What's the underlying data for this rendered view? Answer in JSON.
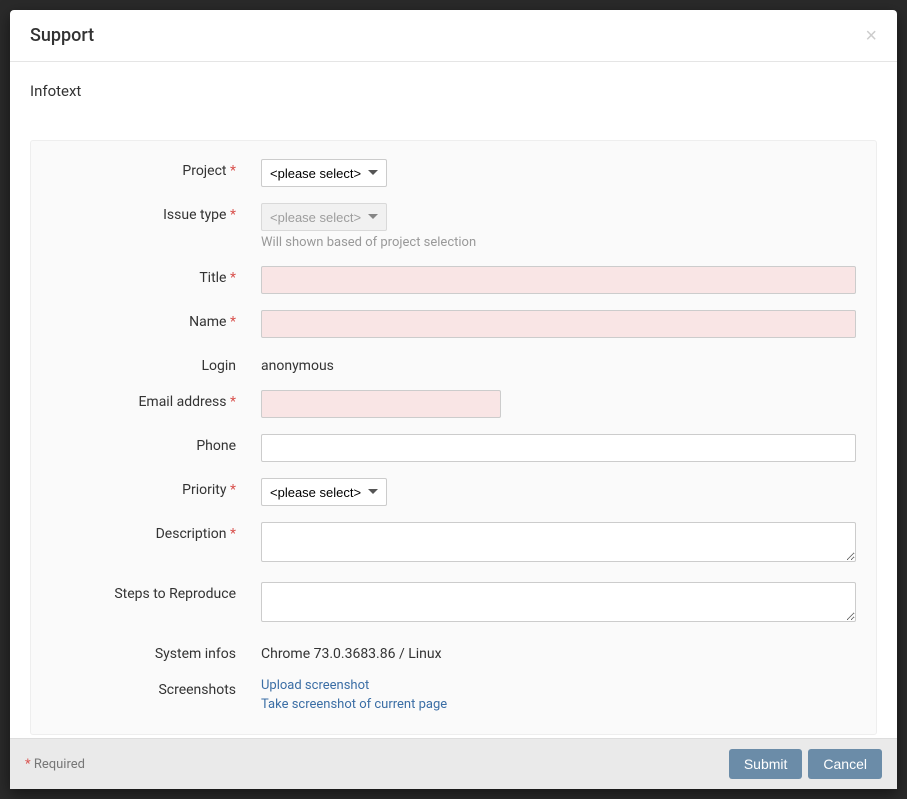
{
  "header": {
    "title": "Support"
  },
  "body": {
    "infotext": "Infotext"
  },
  "form": {
    "project": {
      "label": "Project",
      "placeholder": "<please select>"
    },
    "issueType": {
      "label": "Issue type",
      "placeholder": "<please select>",
      "help": "Will shown based of project selection"
    },
    "title": {
      "label": "Title"
    },
    "name": {
      "label": "Name"
    },
    "login": {
      "label": "Login",
      "value": "anonymous"
    },
    "email": {
      "label": "Email address"
    },
    "phone": {
      "label": "Phone"
    },
    "priority": {
      "label": "Priority",
      "placeholder": "<please select>"
    },
    "description": {
      "label": "Description"
    },
    "steps": {
      "label": "Steps to Reproduce"
    },
    "systemInfos": {
      "label": "System infos",
      "value": "Chrome 73.0.3683.86 / Linux"
    },
    "screenshots": {
      "label": "Screenshots",
      "upload": "Upload screenshot",
      "take": "Take screenshot of current page"
    }
  },
  "footer": {
    "requiredNote": "Required",
    "submit": "Submit",
    "cancel": "Cancel"
  }
}
